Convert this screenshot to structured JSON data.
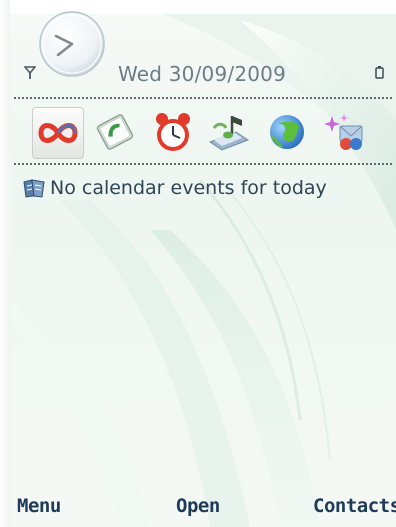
{
  "status": {
    "date": "Wed 30/09/2009"
  },
  "shortcuts": [
    {
      "icon": "active-notes-icon",
      "selected": true
    },
    {
      "icon": "log-icon",
      "selected": false
    },
    {
      "icon": "alarm-clock-icon",
      "selected": false
    },
    {
      "icon": "music-player-icon",
      "selected": false
    },
    {
      "icon": "web-icon",
      "selected": false
    },
    {
      "icon": "messaging-icon",
      "selected": false
    }
  ],
  "events": {
    "text": "No calendar events for today",
    "icon": "calendar-icon"
  },
  "softkeys": {
    "left": "Menu",
    "middle": "Open",
    "right": "Contacts"
  },
  "colors": {
    "date_text": "#6c7d86",
    "softkey_text": "#1f3b59",
    "events_text": "#2f4556"
  }
}
